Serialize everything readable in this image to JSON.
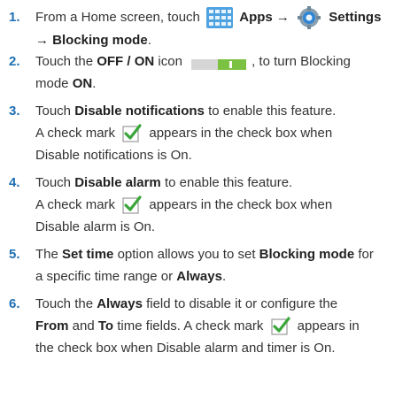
{
  "steps": [
    {
      "num": "1.",
      "parts": {
        "text_a": "From a Home screen, touch",
        "apps": "Apps",
        "arrow1": "→",
        "settings": "Settings",
        "arrow2": "→",
        "blocking": "Blocking mode",
        "period": "."
      }
    },
    {
      "num": "2.",
      "parts": {
        "text_a": "Touch the",
        "offon": "OFF / ON",
        "text_b": "icon",
        "text_c": ", to turn Blocking",
        "text_d": "mode",
        "on": "ON",
        "period": "."
      }
    },
    {
      "num": "3.",
      "parts": {
        "text_a": "Touch",
        "disable_notifications": "Disable notifications",
        "text_b": "to enable this feature.",
        "text_c": "A check mark",
        "text_d": "appears in the check box when",
        "text_e": "Disable notifications is On."
      }
    },
    {
      "num": "4.",
      "parts": {
        "text_a": "Touch",
        "disable_alarm": "Disable alarm",
        "text_b": "to enable this feature.",
        "text_c": "A check mark",
        "text_d": "appears in the check box when",
        "text_e": "Disable alarm is On."
      }
    },
    {
      "num": "5.",
      "parts": {
        "text_a": "The",
        "set_time": "Set time",
        "text_b": "option allows you to set",
        "blocking_mode": "Blocking mode",
        "text_c": "for",
        "text_d": "a specific time range or",
        "always": "Always",
        "period": "."
      }
    },
    {
      "num": "6.",
      "parts": {
        "text_a": "Touch the",
        "always": "Always",
        "text_b": "field to disable it or configure the",
        "from": "From",
        "text_c": "and",
        "to": "To",
        "text_d": "time fields. A check mark",
        "text_e": "appears in",
        "text_f": "the check box when Disable alarm and timer is On."
      }
    }
  ],
  "colors": {
    "number": "#1f6fb4",
    "text": "#333333",
    "check_green": "#3aa63a",
    "toggle_green": "#7cc242"
  },
  "icons": [
    "apps-icon",
    "settings-icon",
    "toggle-icon",
    "check-icon"
  ]
}
